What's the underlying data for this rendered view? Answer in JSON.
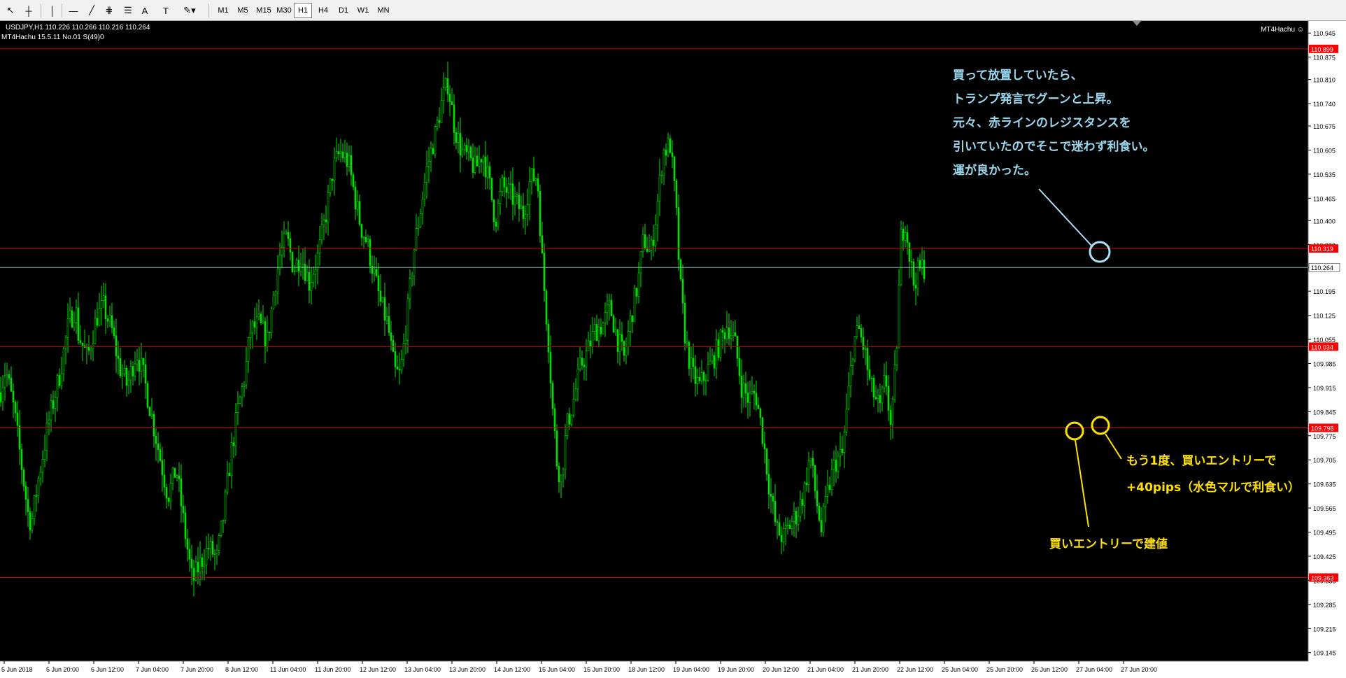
{
  "toolbar": {
    "tools": [
      {
        "name": "cursor-tool",
        "glyph": "↖"
      },
      {
        "name": "crosshair-tool",
        "glyph": "┼"
      },
      {
        "name": "vertical-line-tool",
        "glyph": "│"
      },
      {
        "name": "horizontal-line-tool",
        "glyph": "—"
      },
      {
        "name": "trendline-tool",
        "glyph": "╱"
      },
      {
        "name": "channel-tool",
        "glyph": "⋕"
      },
      {
        "name": "fibonacci-tool",
        "glyph": "☰"
      },
      {
        "name": "text-tool",
        "glyph": "A"
      },
      {
        "name": "label-tool",
        "glyph": "T"
      },
      {
        "name": "shapes-dropdown",
        "glyph": "✎▾"
      }
    ],
    "timeframes": [
      "M1",
      "M5",
      "M15",
      "M30",
      "H1",
      "H4",
      "D1",
      "W1",
      "MN"
    ],
    "active_timeframe": "H1"
  },
  "header": {
    "symbol_line": "USDJPY,H1  110.226 110.266 110.216 110.264",
    "indicator_line": "MT4Hachu 15.5.11   No.01  S(49)0",
    "ea_label": "MT4Hachu ☺"
  },
  "colors": {
    "background": "#000000",
    "candle": "#00e000",
    "hline": "#cc0000",
    "bid_line": "#7fb0b0",
    "price_label_red": "#ff0000",
    "annotation_blue": "#9ad8f0",
    "annotation_yellow": "#ffe000",
    "circle_blue": "#a9e0f7",
    "circle_yellow": "#ffe000"
  },
  "chart_data": {
    "type": "candlestick",
    "symbol": "USDJPY",
    "timeframe": "H1",
    "ylim": [
      109.12,
      110.98
    ],
    "y_ticks": [
      "110.945",
      "110.875",
      "110.810",
      "110.740",
      "110.675",
      "110.605",
      "110.535",
      "110.465",
      "110.400",
      "110.330",
      "110.264",
      "110.195",
      "110.125",
      "110.055",
      "109.985",
      "109.915",
      "109.845",
      "109.775",
      "109.705",
      "109.635",
      "109.565",
      "109.495",
      "109.425",
      "109.355",
      "109.285",
      "109.215",
      "109.145"
    ],
    "x_ticks": [
      "5 Jun 2018",
      "5 Jun 20:00",
      "6 Jun 12:00",
      "7 Jun 04:00",
      "7 Jun 20:00",
      "8 Jun 12:00",
      "11 Jun 04:00",
      "11 Jun 20:00",
      "12 Jun 12:00",
      "13 Jun 04:00",
      "13 Jun 20:00",
      "14 Jun 12:00",
      "15 Jun 04:00",
      "15 Jun 20:00",
      "18 Jun 12:00",
      "19 Jun 04:00",
      "19 Jun 20:00",
      "20 Jun 12:00",
      "21 Jun 04:00",
      "21 Jun 20:00",
      "22 Jun 12:00",
      "25 Jun 04:00",
      "25 Jun 20:00",
      "26 Jun 12:00",
      "27 Jun 04:00",
      "27 Jun 20:00"
    ],
    "path_points": [
      [
        0,
        109.9
      ],
      [
        8,
        109.97
      ],
      [
        20,
        109.85
      ],
      [
        30,
        109.7
      ],
      [
        40,
        109.55
      ],
      [
        45,
        109.52
      ],
      [
        55,
        109.65
      ],
      [
        70,
        109.82
      ],
      [
        85,
        109.95
      ],
      [
        98,
        110.1
      ],
      [
        108,
        110.15
      ],
      [
        112,
        110.07
      ],
      [
        125,
        110.0
      ],
      [
        138,
        110.12
      ],
      [
        148,
        110.15
      ],
      [
        160,
        110.08
      ],
      [
        170,
        109.98
      ],
      [
        182,
        109.92
      ],
      [
        195,
        110.02
      ],
      [
        205,
        109.95
      ],
      [
        215,
        109.85
      ],
      [
        228,
        109.72
      ],
      [
        240,
        109.6
      ],
      [
        252,
        109.68
      ],
      [
        264,
        109.5
      ],
      [
        275,
        109.35
      ],
      [
        285,
        109.4
      ],
      [
        298,
        109.45
      ],
      [
        310,
        109.42
      ],
      [
        320,
        109.55
      ],
      [
        330,
        109.72
      ],
      [
        340,
        109.85
      ],
      [
        350,
        109.95
      ],
      [
        358,
        110.08
      ],
      [
        370,
        110.1
      ],
      [
        382,
        110.05
      ],
      [
        392,
        110.2
      ],
      [
        400,
        110.3
      ],
      [
        410,
        110.35
      ],
      [
        420,
        110.26
      ],
      [
        430,
        110.3
      ],
      [
        442,
        110.22
      ],
      [
        455,
        110.3
      ],
      [
        466,
        110.42
      ],
      [
        476,
        110.55
      ],
      [
        486,
        110.6
      ],
      [
        498,
        110.57
      ],
      [
        508,
        110.46
      ],
      [
        516,
        110.38
      ],
      [
        524,
        110.34
      ],
      [
        534,
        110.25
      ],
      [
        544,
        110.16
      ],
      [
        554,
        110.1
      ],
      [
        564,
        109.96
      ],
      [
        572,
        109.95
      ],
      [
        582,
        110.12
      ],
      [
        592,
        110.32
      ],
      [
        600,
        110.42
      ],
      [
        610,
        110.55
      ],
      [
        622,
        110.65
      ],
      [
        632,
        110.75
      ],
      [
        640,
        110.8
      ],
      [
        650,
        110.67
      ],
      [
        660,
        110.6
      ],
      [
        670,
        110.58
      ],
      [
        680,
        110.55
      ],
      [
        690,
        110.6
      ],
      [
        700,
        110.5
      ],
      [
        708,
        110.4
      ],
      [
        718,
        110.5
      ],
      [
        728,
        110.48
      ],
      [
        738,
        110.45
      ],
      [
        748,
        110.42
      ],
      [
        758,
        110.52
      ],
      [
        768,
        110.53
      ],
      [
        776,
        110.25
      ],
      [
        784,
        110.05
      ],
      [
        790,
        109.85
      ],
      [
        796,
        109.7
      ],
      [
        802,
        109.65
      ],
      [
        810,
        109.8
      ],
      [
        820,
        109.88
      ],
      [
        830,
        109.98
      ],
      [
        840,
        110.02
      ],
      [
        850,
        110.08
      ],
      [
        862,
        110.1
      ],
      [
        872,
        110.15
      ],
      [
        882,
        110.06
      ],
      [
        892,
        110.0
      ],
      [
        902,
        110.12
      ],
      [
        912,
        110.22
      ],
      [
        920,
        110.35
      ],
      [
        930,
        110.3
      ],
      [
        938,
        110.42
      ],
      [
        948,
        110.6
      ],
      [
        958,
        110.62
      ],
      [
        966,
        110.45
      ],
      [
        972,
        110.22
      ],
      [
        980,
        110.05
      ],
      [
        990,
        109.95
      ],
      [
        1000,
        109.92
      ],
      [
        1010,
        109.96
      ],
      [
        1020,
        110.0
      ],
      [
        1030,
        110.05
      ],
      [
        1040,
        110.1
      ],
      [
        1050,
        110.05
      ],
      [
        1060,
        109.92
      ],
      [
        1070,
        109.88
      ],
      [
        1080,
        109.9
      ],
      [
        1090,
        109.78
      ],
      [
        1100,
        109.62
      ],
      [
        1110,
        109.5
      ],
      [
        1120,
        109.48
      ],
      [
        1130,
        109.52
      ],
      [
        1140,
        109.55
      ],
      [
        1150,
        109.62
      ],
      [
        1158,
        109.72
      ],
      [
        1166,
        109.6
      ],
      [
        1174,
        109.5
      ],
      [
        1184,
        109.62
      ],
      [
        1194,
        109.7
      ],
      [
        1204,
        109.72
      ],
      [
        1212,
        109.88
      ],
      [
        1220,
        110.05
      ],
      [
        1228,
        110.08
      ],
      [
        1236,
        110.02
      ],
      [
        1244,
        109.92
      ],
      [
        1252,
        109.88
      ],
      [
        1258,
        109.85
      ],
      [
        1266,
        109.95
      ],
      [
        1274,
        109.78
      ],
      [
        1282,
        110.05
      ],
      [
        1288,
        110.35
      ],
      [
        1294,
        110.4
      ],
      [
        1300,
        110.3
      ],
      [
        1306,
        110.22
      ],
      [
        1312,
        110.25
      ],
      [
        1318,
        110.264
      ]
    ],
    "resistance_lines": [
      110.899,
      110.319,
      110.034,
      109.798,
      109.363
    ],
    "resistance_labels": [
      "110.899",
      "110.319",
      "110.034",
      "109.798",
      "109.363"
    ],
    "bid": 110.264,
    "bid_label": "110.264"
  },
  "annotations": {
    "blue_text": [
      "買って放置していたら、",
      "トランプ発言でグーンと上昇。",
      "元々、赤ラインのレジスタンスを",
      "引いていたのでそこで迷わず利食い。",
      "運が良かった。"
    ],
    "yellow_text_1": "買いエントリーで建値",
    "yellow_text_2a": "もう1度、買いエントリーで",
    "yellow_text_2b": "+40pips（水色マルで利食い）"
  }
}
